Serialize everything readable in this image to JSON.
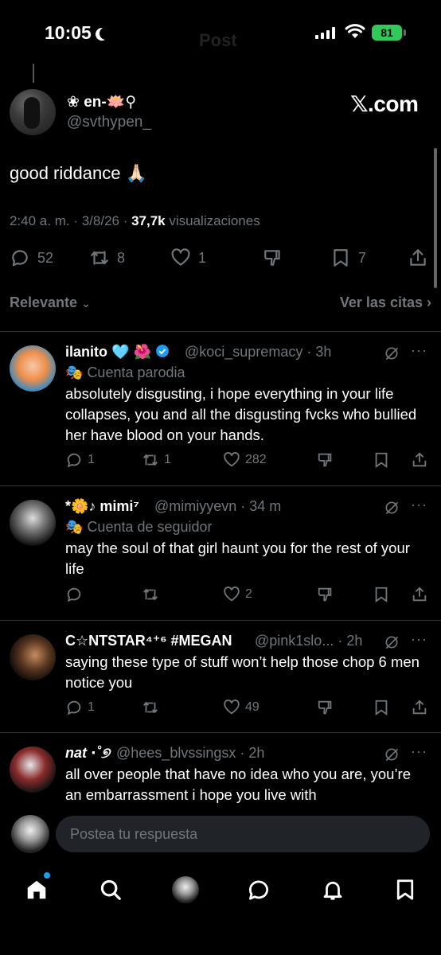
{
  "status_bar": {
    "time": "10:05",
    "battery": "81"
  },
  "header": {
    "ghost_title": "Post"
  },
  "main_post": {
    "author_name": "❀ en-🪷⚲",
    "author_handle": "@svthypen_",
    "watermark": "𝕏.com",
    "text": "good riddance 🙏🏻",
    "time": "2:40 a. m.",
    "date": "3/8/26",
    "views_count": "37,7k",
    "views_label": "visualizaciones",
    "replies": "52",
    "reposts": "8",
    "likes": "1",
    "bookmarks": "7"
  },
  "sort": {
    "relevant": "Relevante",
    "quotes": "Ver las citas"
  },
  "replies": [
    {
      "name": "ilanito 🩵",
      "name_emoji": "🌺",
      "verified": true,
      "handle": "@koci_supremacy",
      "time": "3h",
      "label": "Cuenta parodia",
      "text": "absolutely disgusting, i hope everything in your life collapses, you and all the disgusting fvcks who bullied her have blood on your hands.",
      "replies": "1",
      "reposts": "1",
      "likes": "282"
    },
    {
      "name": "*🌼♪ mimi⁷",
      "handle": "@mimiyyevn",
      "time": "34 m",
      "label": "Cuenta de seguidor",
      "text": "may the soul of that girl haunt you for the rest of your life",
      "replies": "",
      "reposts": "",
      "likes": "2"
    },
    {
      "name": "C☆NTSTAR⁴⁺⁶ #MEGAN",
      "handle": "@pink1slo...",
      "time": "2h",
      "text": "saying these type of stuff won’t help those chop 6 men notice you",
      "replies": "1",
      "reposts": "",
      "likes": "49"
    },
    {
      "name": "nat ⋅˚୭",
      "handle": "@hees_blvssingsx",
      "time": "2h",
      "text": "all over people that have no idea who you are, you’re an embarrassment i hope you live with"
    }
  ],
  "composer": {
    "placeholder": "Postea tu respuesta"
  },
  "colors": {
    "background": "#000000",
    "muted": "#71767b",
    "accent": "#1d9bf0",
    "divider": "#2f3336",
    "battery": "#34c759"
  },
  "icons": [
    "moon-icon",
    "signal-icon",
    "wifi-icon",
    "battery-icon",
    "reply-icon",
    "repost-icon",
    "like-icon",
    "dislike-icon",
    "bookmark-icon",
    "share-icon",
    "grok-icon",
    "more-icon",
    "home-icon",
    "search-icon",
    "chat-icon",
    "bell-icon"
  ]
}
